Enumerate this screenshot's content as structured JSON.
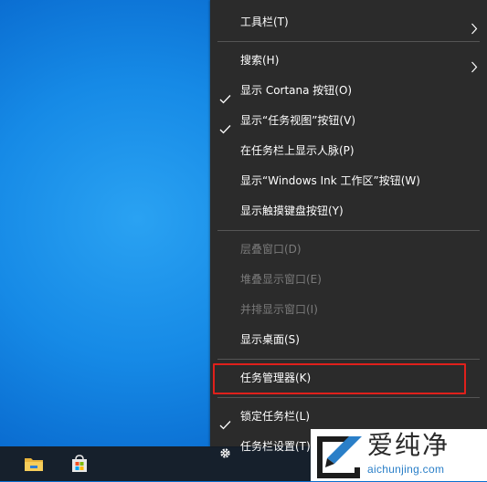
{
  "menu": {
    "items": [
      {
        "label": "工具栏(T)",
        "checked": false,
        "submenu": true,
        "disabled": false
      },
      {
        "label": "搜索(H)",
        "checked": false,
        "submenu": true,
        "disabled": false
      },
      {
        "label": "显示 Cortana 按钮(O)",
        "checked": true,
        "submenu": false,
        "disabled": false
      },
      {
        "label": "显示“任务视图”按钮(V)",
        "checked": true,
        "submenu": false,
        "disabled": false
      },
      {
        "label": "在任务栏上显示人脉(P)",
        "checked": false,
        "submenu": false,
        "disabled": false
      },
      {
        "label": "显示“Windows Ink 工作区”按钮(W)",
        "checked": false,
        "submenu": false,
        "disabled": false
      },
      {
        "label": "显示触摸键盘按钮(Y)",
        "checked": false,
        "submenu": false,
        "disabled": false
      },
      {
        "label": "层叠窗口(D)",
        "checked": false,
        "submenu": false,
        "disabled": true
      },
      {
        "label": "堆叠显示窗口(E)",
        "checked": false,
        "submenu": false,
        "disabled": true
      },
      {
        "label": "并排显示窗口(I)",
        "checked": false,
        "submenu": false,
        "disabled": true
      },
      {
        "label": "显示桌面(S)",
        "checked": false,
        "submenu": false,
        "disabled": false
      },
      {
        "label": "任务管理器(K)",
        "checked": false,
        "submenu": false,
        "disabled": false,
        "highlighted": true
      },
      {
        "label": "锁定任务栏(L)",
        "checked": true,
        "submenu": false,
        "disabled": false
      },
      {
        "label": "任务栏设置(T)",
        "checked": false,
        "submenu": false,
        "disabled": false,
        "icon": "gear-icon"
      }
    ]
  },
  "taskbar": {
    "icons": [
      "file-explorer-icon",
      "microsoft-store-icon"
    ]
  },
  "watermark": {
    "title": "爱纯净",
    "url": "aichunjing.com"
  },
  "colors": {
    "menu_bg": "#2b2b2b",
    "menu_text": "#ffffff",
    "disabled_text": "#7a7a7a",
    "highlight_border": "#e0201b",
    "taskbar_bg": "#16202c"
  }
}
